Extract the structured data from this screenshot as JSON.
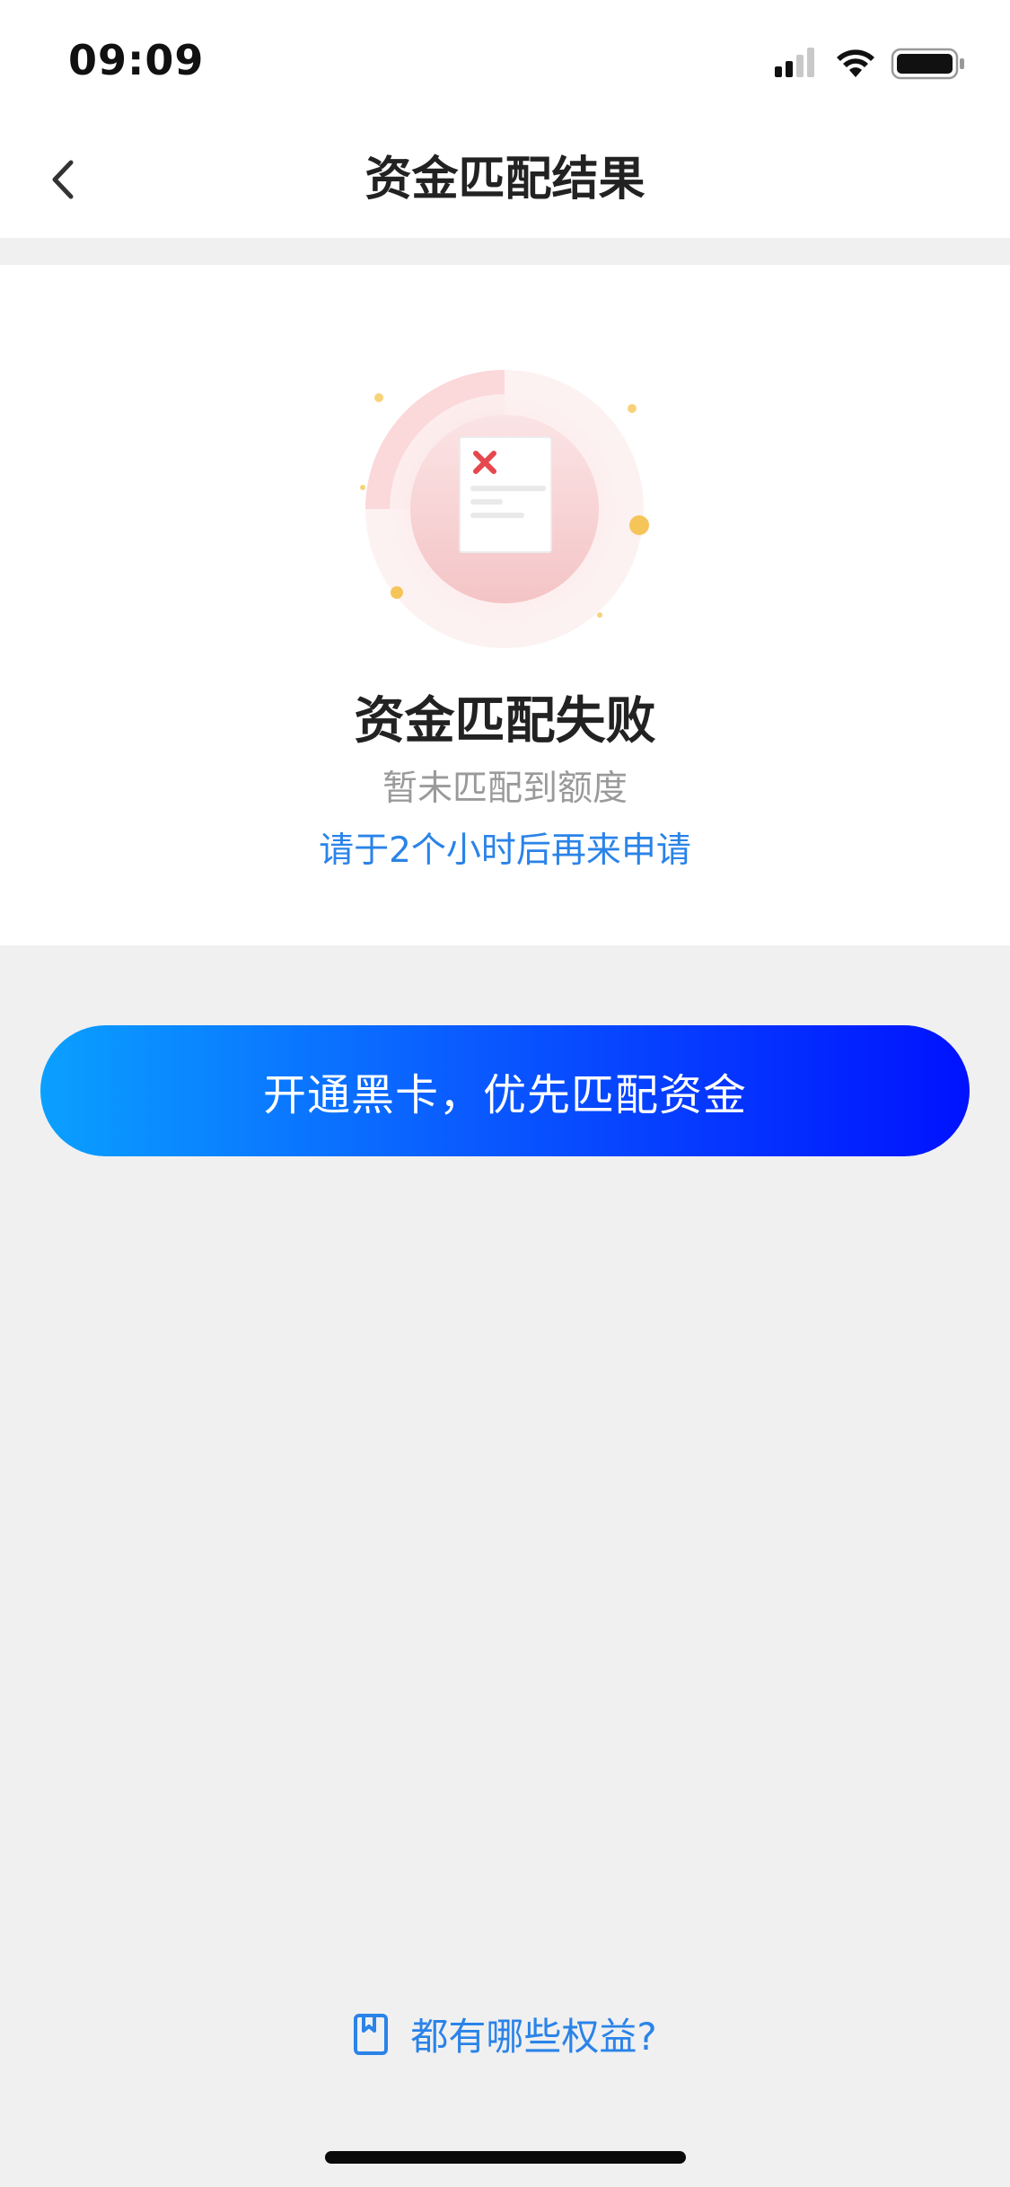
{
  "status_bar": {
    "time": "09:09"
  },
  "nav": {
    "title": "资金匹配结果"
  },
  "result": {
    "title": "资金匹配失败",
    "subtitle": "暂未匹配到额度",
    "hint": "请于2个小时后再来申请"
  },
  "cta": {
    "label": "开通黑卡，优先匹配资金"
  },
  "benefits": {
    "label": "都有哪些权益?"
  },
  "colors": {
    "accent_blue": "#2a83e8",
    "gradient_start": "#0aa0ff",
    "gradient_end": "#0012ff",
    "error_red": "#e5484d"
  },
  "icons": [
    "back-arrow-icon",
    "signal-icon",
    "wifi-icon",
    "battery-icon",
    "failed-document-icon",
    "book-icon"
  ]
}
